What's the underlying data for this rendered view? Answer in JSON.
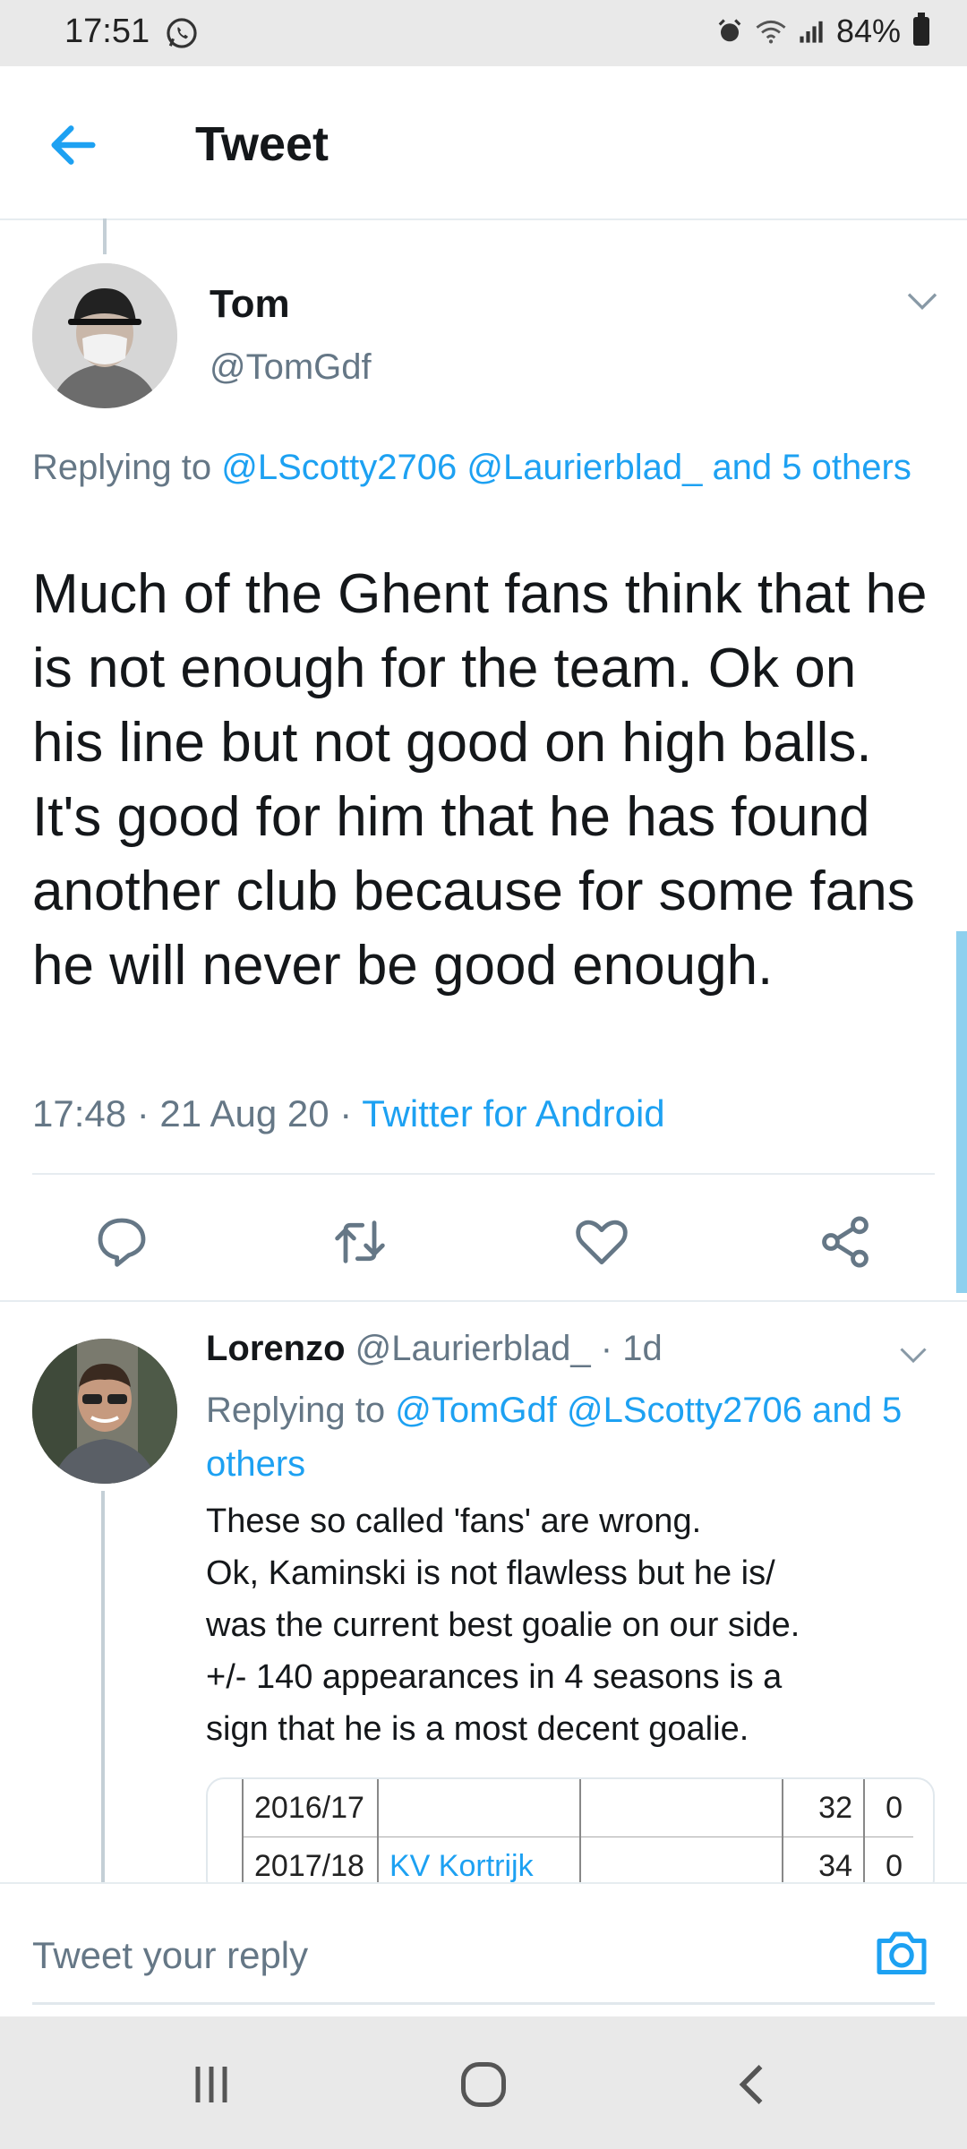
{
  "status_bar": {
    "time": "17:51",
    "battery": "84%"
  },
  "header": {
    "title": "Tweet"
  },
  "main_tweet": {
    "name": "Tom",
    "handle": "@TomGdf",
    "replying_prefix": "Replying to ",
    "replying_links": "@LScotty2706 @Laurierblad_ and 5 others",
    "text": "Much of the Ghent fans think that he is not enough for the team. Ok on his line but not good on high balls. It's good for him that he has found another club because for some fans he will never be good enough.",
    "time": "17:48 · 21 Aug 20 · ",
    "client": "Twitter for Android"
  },
  "actions": [
    "reply-icon",
    "retweet-icon",
    "like-icon",
    "share-icon"
  ],
  "reply_tweet": {
    "name": "Lorenzo",
    "handle": "@Laurierblad_",
    "age": " · 1d",
    "replying_prefix": "Replying to ",
    "replying_links": "@TomGdf @LScotty2706 and 5 others",
    "text_lines": [
      "These so called 'fans' are wrong.",
      "Ok, Kaminski is not flawless but he is/",
      "was the current best goalie on our side.",
      "+/- 140 appearances in 4 seasons is a",
      "sign that he is a most decent goalie."
    ],
    "table": {
      "rows": [
        [
          "2016/17",
          "",
          "",
          "32",
          "0"
        ],
        [
          "2017/18",
          "KV Kortrijk",
          "",
          "34",
          "0"
        ]
      ]
    }
  },
  "composer": {
    "placeholder": "Tweet your reply"
  },
  "colors": {
    "accent": "#1da1f2",
    "secondary": "#657786"
  }
}
